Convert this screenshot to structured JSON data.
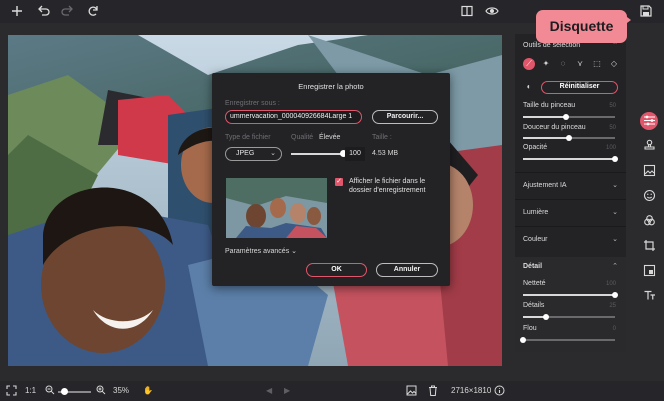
{
  "toolbar": {
    "icons": [
      "plus-icon",
      "undo-icon",
      "redo-icon",
      "refresh-icon",
      "compare-icon",
      "eye-icon",
      "save-icon"
    ]
  },
  "tooltip": {
    "text": "Disquette"
  },
  "dialog": {
    "title": "Enregistrer la photo",
    "save_as_label": "Enregistrer sous :",
    "filename": "ummervacation_000040926684Large 1",
    "browse_label": "Parcourir...",
    "file_type_label": "Type de fichier",
    "quality_label": "Qualité",
    "quality_text": "Élevée",
    "size_label": "Taille :",
    "file_type_value": "JPEG",
    "quality_value": "100",
    "quality_fraction": 1.0,
    "size_value": "4.53 MB",
    "show_file_label": "Afficher le fichier dans le dossier d'enregistrement",
    "show_file_checked": true,
    "advanced_label": "Paramètres avancés",
    "ok_label": "OK",
    "cancel_label": "Annuler"
  },
  "panel": {
    "selection_title": "Outils de sélection",
    "reset_label": "Réinitialiser",
    "brush_size_label": "Taille du pinceau",
    "brush_size_value": "50",
    "brush_size_fraction": 0.47,
    "brush_softness_label": "Douceur du pinceau",
    "brush_softness_value": "50",
    "brush_softness_fraction": 0.5,
    "opacity_label": "Opacité",
    "opacity_value": "100",
    "opacity_fraction": 1.0,
    "ai_adjust_title": "Ajustement IA",
    "light_title": "Lumière",
    "color_title": "Couleur",
    "detail_title": "Détail",
    "sharpness_label": "Netteté",
    "sharpness_value": "100",
    "sharpness_fraction": 1.0,
    "details_label": "Détails",
    "details_value": "25",
    "details_fraction": 0.25,
    "blur_label": "Flou",
    "blur_value": "0",
    "blur_fraction": 0.0
  },
  "right_tools": [
    "sliders-icon",
    "stamp-icon",
    "image-icon",
    "smiley-icon",
    "effects-icon",
    "crop-icon",
    "layers-icon",
    "text-icon"
  ],
  "bottom": {
    "ratio_label": "1:1",
    "zoom_value": "35%",
    "zoom_fraction": 0.08,
    "dimensions": "2716×1810",
    "colors": {
      "accent": "#e0566a",
      "tooltip": "#f28a96"
    }
  }
}
